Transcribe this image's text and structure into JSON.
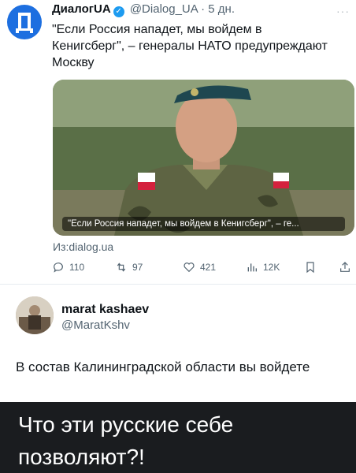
{
  "quoted_post": {
    "author_name": "ДиалогUA",
    "handle": "@Dialog_UA",
    "separator": "·",
    "age": "5 дн.",
    "more_label": "···",
    "text": "\"Если Россия нападет, мы войдем в Кенигсберг\", – генералы НАТО предупреждают Москву",
    "media_caption": "\"Если Россия нападет, мы войдем в Кенигсберг\", – ге...",
    "source": "Из:dialog.ua",
    "metrics": {
      "replies": "110",
      "reposts": "97",
      "likes": "421",
      "views": "12K"
    }
  },
  "reply_post": {
    "author_name": "marat kashaev",
    "handle": "@MaratKshv",
    "text": "В состав Калининградской области вы войдете"
  },
  "footer": {
    "text": "Что эти русские себе позволяют?!"
  },
  "colors": {
    "brand_blue": "#1d6fe0",
    "verified_blue": "#1d9bf0",
    "muted_text": "#536471",
    "footer_bg": "#1a1c1f"
  }
}
